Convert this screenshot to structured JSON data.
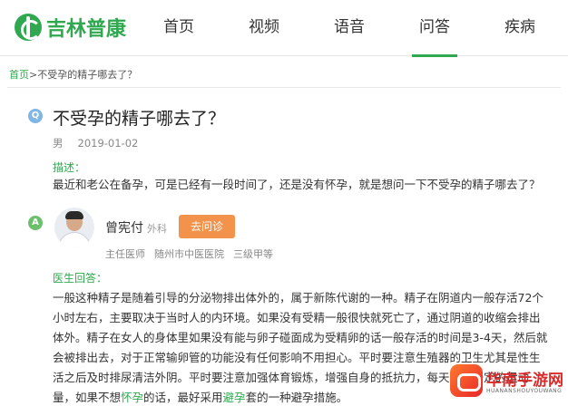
{
  "header": {
    "logo_text": "吉林普康",
    "nav": [
      {
        "label": "首页",
        "active": false
      },
      {
        "label": "视频",
        "active": false
      },
      {
        "label": "语音",
        "active": false
      },
      {
        "label": "问答",
        "active": true
      },
      {
        "label": "疾病",
        "active": false
      }
    ],
    "accent_color": "#2fa84f"
  },
  "breadcrumb": {
    "home": "首页",
    "separator": ">",
    "current": "不受孕的精子哪去了？"
  },
  "question": {
    "badge": "Q",
    "title": "不受孕的精子哪去了？",
    "gender": "男",
    "date": "2019-01-02",
    "description_label": "描述：",
    "description": "最近和老公在备孕，可是已经有一段时间了，还是没有怀孕，就是想问一下不受孕的精子哪去了？"
  },
  "doctor": {
    "badge": "A",
    "name": "曾宪付",
    "department": "外科",
    "visit_button": "去问诊",
    "title": "主任医师",
    "hospital": "随州市中医医院",
    "level": "三级甲等"
  },
  "answer": {
    "label": "医生回答：",
    "lines": [
      "一般这种精子是随着引导的分泌物排出体外的，属于新陈代谢的一种。精子在阴道内一般存活72个",
      "小时左右，主要取决于当时人的内环境。如果没有受精一般很快就死亡了，通过阴道的收缩会排出",
      "体外。精子在女人的身体里如果没有能与卵子碰面成为受精卵的话一般存活的时间是3-4天，然后就",
      "会被排出去，对于正常输卵管的功能没有任何影响不用担心。平时要注意生殖器的卫生尤其是性生",
      "活之后及时排尿清洁外阴。平时要注意加强体育锻炼，增强自身的抵抗力，每天要有一定的运动"
    ],
    "last_line": {
      "part1": "量，如果不想",
      "hl1": "怀孕",
      "part2": "的话，最好采用",
      "hl2": "避孕",
      "part3": "套的一种避孕措施。"
    }
  },
  "watermark": {
    "text": "华南手游网",
    "sub": "HUANANSHOUYOUWANG"
  }
}
